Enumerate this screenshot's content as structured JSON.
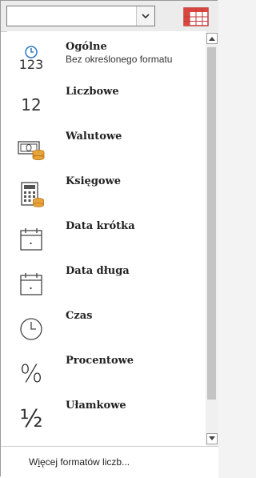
{
  "combo": {
    "value": "",
    "dropdown_icon": "chevron-down-icon"
  },
  "toolbar": {
    "conditional_format_icon": "table-grid-icon"
  },
  "formats": [
    {
      "id": "general",
      "label": "Ogólne",
      "sample": "Bez określonego formatu",
      "icon": "clock-123-icon",
      "icon_text": "123"
    },
    {
      "id": "number",
      "label": "Liczbowe",
      "sample": "",
      "icon": "number-12-icon",
      "icon_text": "12"
    },
    {
      "id": "currency",
      "label": "Walutowe",
      "sample": "",
      "icon": "currency-icon",
      "icon_text": ""
    },
    {
      "id": "accounting",
      "label": "Księgowe",
      "sample": "",
      "icon": "calculator-icon",
      "icon_text": ""
    },
    {
      "id": "short-date",
      "label": "Data krótka",
      "sample": "",
      "icon": "calendar-icon",
      "icon_text": ""
    },
    {
      "id": "long-date",
      "label": "Data długa",
      "sample": "",
      "icon": "calendar-icon",
      "icon_text": ""
    },
    {
      "id": "time",
      "label": "Czas",
      "sample": "",
      "icon": "clock-icon",
      "icon_text": ""
    },
    {
      "id": "percent",
      "label": "Procentowe",
      "sample": "",
      "icon": "percent-icon",
      "icon_text": "%"
    },
    {
      "id": "fraction",
      "label": "Ułamkowe",
      "sample": "",
      "icon": "fraction-icon",
      "icon_text": "½"
    }
  ],
  "footer": {
    "more_first": "W",
    "more_accel": "i",
    "more_rest": "ęcej formatów liczb..."
  },
  "colors": {
    "accent_blue": "#2b79c2",
    "coin_orange": "#e8a33a",
    "grid_red": "#d9453f"
  }
}
